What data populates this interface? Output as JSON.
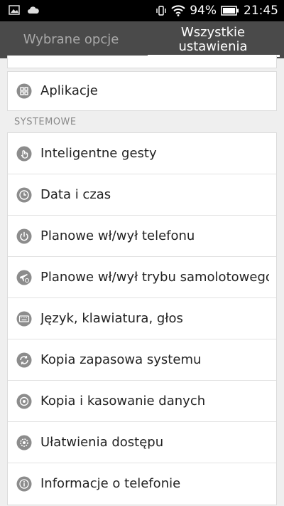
{
  "status_bar": {
    "battery_percent": "94%",
    "time": "21:45",
    "icons": [
      "image-icon",
      "cloud-icon",
      "vibrate-icon",
      "wifi-icon",
      "battery-icon"
    ]
  },
  "tabs": [
    {
      "label": "Wybrane opcje",
      "active": false
    },
    {
      "label": "Wszystkie ustawienia",
      "active": true
    }
  ],
  "apps_item": {
    "label": "Aplikacje",
    "icon": "apps-icon"
  },
  "system_section": {
    "header": "SYSTEMOWE",
    "items": [
      {
        "label": "Inteligentne gesty",
        "icon": "gesture-icon"
      },
      {
        "label": "Data i czas",
        "icon": "clock-icon"
      },
      {
        "label": "Planowe wł/wył telefonu",
        "icon": "power-icon"
      },
      {
        "label": "Planowe wł/wył trybu samolotowego",
        "icon": "airplane-icon"
      },
      {
        "label": "Język, klawiatura, głos",
        "icon": "keyboard-icon"
      },
      {
        "label": "Kopia zapasowa systemu",
        "icon": "backup-icon"
      },
      {
        "label": "Kopia i kasowanie danych",
        "icon": "reset-icon"
      },
      {
        "label": "Ułatwienia dostępu",
        "icon": "accessibility-icon"
      },
      {
        "label": "Informacje o telefonie",
        "icon": "info-icon"
      }
    ]
  },
  "colors": {
    "tab_bar": "#4a4a4a",
    "icon_gray": "#8c8c8c",
    "background": "#efefef"
  }
}
